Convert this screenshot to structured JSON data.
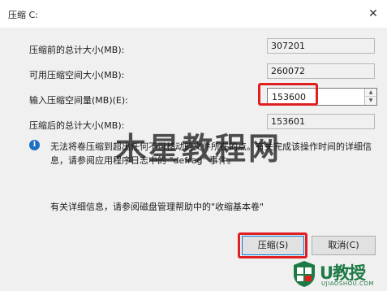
{
  "dialog": {
    "title": "压缩 C:",
    "close_symbol": "✕"
  },
  "fields": {
    "total_before_label": "压缩前的总计大小(MB):",
    "total_before_value": "307201",
    "available_label": "可用压缩空间大小(MB):",
    "available_value": "260072",
    "input_label": "输入压缩空间量(MB)(E):",
    "input_value": "153600",
    "total_after_label": "压缩后的总计大小(MB):",
    "total_after_value": "153601"
  },
  "info": {
    "icon": "info-icon",
    "text": "无法将卷压缩到超出任何不可移动的文件所在的点。有关完成该操作时间的详细信息，请参阅应用程序日志中的 \"defrag\" 事件。",
    "help_text": "有关详细信息，请参阅磁盘管理帮助中的\"收缩基本卷\""
  },
  "buttons": {
    "shrink": "压缩(S)",
    "cancel": "取消(C)"
  },
  "watermark": {
    "text": "木星教程网"
  },
  "logo": {
    "brand": "U教授",
    "domain": "UJIAOSHOU.COM",
    "colors": {
      "green": "#1e7a45",
      "red": "#e02020"
    }
  },
  "colors": {
    "highlight": "#e02020",
    "info_blue": "#1c6fc4",
    "dialog_bg": "#f0f0f0"
  }
}
